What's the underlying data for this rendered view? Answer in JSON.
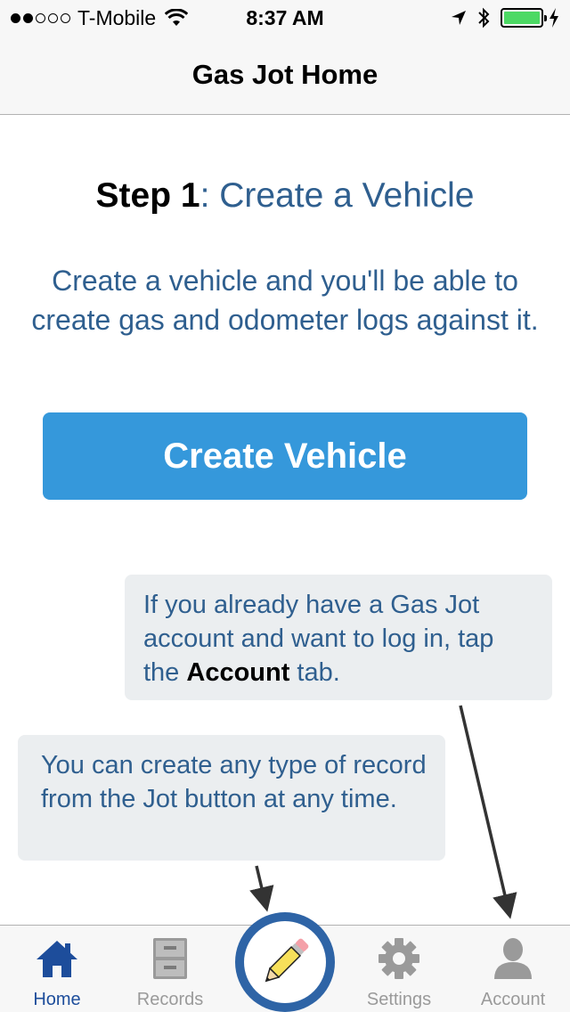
{
  "status_bar": {
    "carrier": "T-Mobile",
    "time": "8:37 AM",
    "signal_bars_filled": 2,
    "signal_bars_total": 5,
    "battery_level": 1.0,
    "icons": [
      "wifi-icon",
      "location-arrow-icon",
      "bluetooth-icon",
      "battery-icon",
      "charging-bolt-icon"
    ]
  },
  "nav": {
    "title": "Gas Jot Home"
  },
  "step": {
    "number": "Step 1",
    "separator": ": ",
    "title": "Create a Vehicle"
  },
  "intro": "Create a vehicle and you'll be able to create gas and odometer logs against it.",
  "create_button_label": "Create Vehicle",
  "tips": {
    "account": {
      "before": "If you already have a Gas Jot account and want to log in, tap the ",
      "bold": "Account",
      "after": " tab."
    },
    "jot": "You can create any type of record from the Jot button at any time."
  },
  "tabs": [
    {
      "label": "Home",
      "icon": "home-icon",
      "active": true
    },
    {
      "label": "Records",
      "icon": "file-cabinet-icon",
      "active": false
    },
    {
      "label": "Jot",
      "icon": "pencil-icon",
      "active": false
    },
    {
      "label": "Settings",
      "icon": "gear-icon",
      "active": false
    },
    {
      "label": "Account",
      "icon": "user-icon",
      "active": false
    }
  ],
  "colors": {
    "accent_blue": "#3598db",
    "text_blue": "#2f5f8f",
    "active_tab": "#1d4d9b",
    "inactive_tab": "#9a9a9a",
    "tip_background": "#ebeef0",
    "jot_ring": "#2e64a6",
    "battery_green": "#4cd964"
  }
}
